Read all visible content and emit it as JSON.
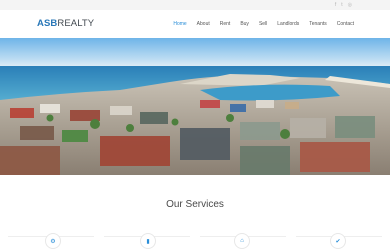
{
  "social": [
    {
      "icon": "facebook-icon",
      "glyph": "f"
    },
    {
      "icon": "twitter-icon",
      "glyph": "t"
    },
    {
      "icon": "instagram-icon",
      "glyph": "◎"
    }
  ],
  "brand": {
    "bold": "ASB",
    "regular": "REALTY"
  },
  "nav": {
    "items": [
      "Home",
      "About",
      "Rent",
      "Buy",
      "Sell",
      "Landlords",
      "Tenants",
      "Contact"
    ],
    "active": "Home"
  },
  "services": {
    "title": "Our Services",
    "items": [
      {
        "icon": "gears-icon",
        "glyph": "⚙"
      },
      {
        "icon": "bar-chart-icon",
        "glyph": "▮"
      },
      {
        "icon": "home-icon",
        "glyph": "⌂"
      },
      {
        "icon": "check-icon",
        "glyph": "✔"
      }
    ]
  },
  "colors": {
    "accent": "#2a8ed8",
    "brand_blue": "#2a78b8",
    "brand_gray": "#444b52"
  }
}
